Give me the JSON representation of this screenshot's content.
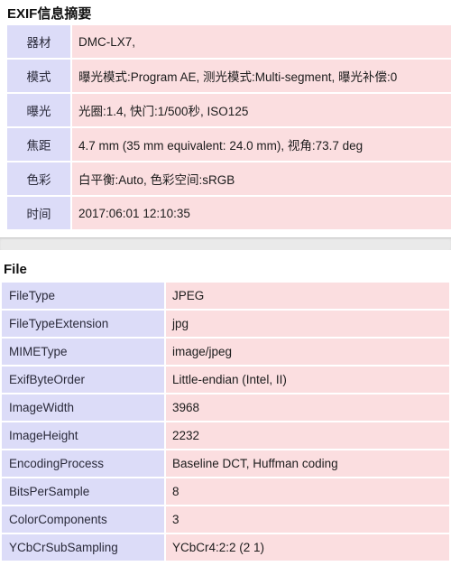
{
  "summary": {
    "title": "EXIF信息摘要",
    "rows": [
      {
        "label": "器材",
        "value": "DMC-LX7,"
      },
      {
        "label": "模式",
        "value": "曝光模式:Program AE, 测光模式:Multi-segment, 曝光补偿:0"
      },
      {
        "label": "曝光",
        "value": "光圈:1.4, 快门:1/500秒, ISO125"
      },
      {
        "label": "焦距",
        "value": "4.7 mm (35 mm equivalent: 24.0 mm), 视角:73.7 deg"
      },
      {
        "label": "色彩",
        "value": "白平衡:Auto, 色彩空间:sRGB"
      },
      {
        "label": "时间",
        "value": "2017:06:01 12:10:35"
      }
    ]
  },
  "file_group": {
    "title": "File",
    "rows": [
      {
        "label": "FileType",
        "value": "JPEG"
      },
      {
        "label": "FileTypeExtension",
        "value": "jpg"
      },
      {
        "label": "MIMEType",
        "value": "image/jpeg"
      },
      {
        "label": "ExifByteOrder",
        "value": "Little-endian (Intel, II)"
      },
      {
        "label": "ImageWidth",
        "value": "3968"
      },
      {
        "label": "ImageHeight",
        "value": "2232"
      },
      {
        "label": "EncodingProcess",
        "value": "Baseline DCT, Huffman coding"
      },
      {
        "label": "BitsPerSample",
        "value": "8"
      },
      {
        "label": "ColorComponents",
        "value": "3"
      },
      {
        "label": "YCbCrSubSampling",
        "value": "YCbCr4:2:2 (2 1)"
      }
    ]
  },
  "colors": {
    "label_cell_bg": "#dcdcf8",
    "value_cell_bg": "#fbdee0",
    "page_bg": "#ffffff",
    "divider_bg": "#eaeaea",
    "text": "#1c1c1c"
  }
}
